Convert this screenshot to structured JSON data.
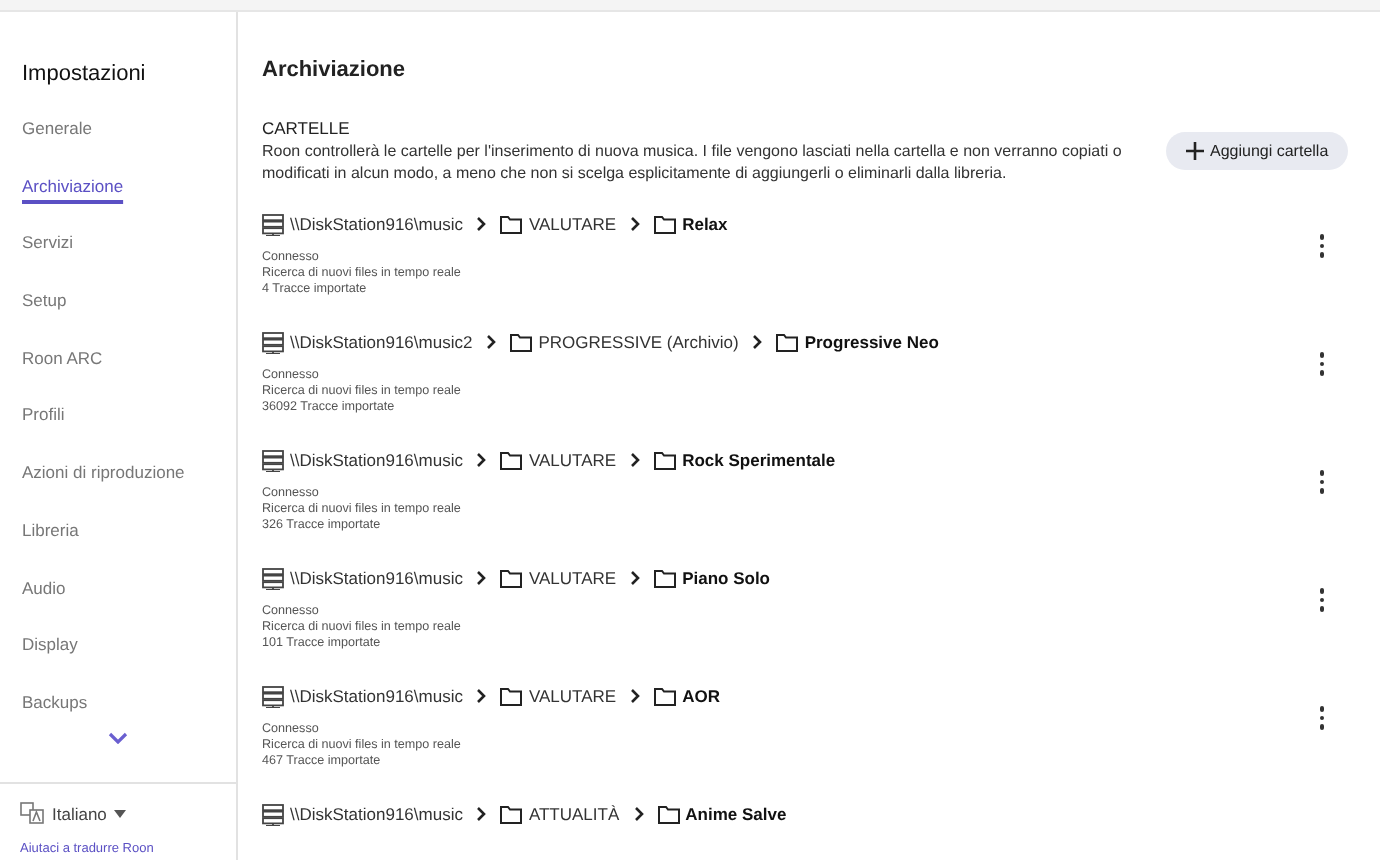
{
  "sidebar": {
    "title": "Impostazioni",
    "items": [
      {
        "label": "Generale",
        "selected": false
      },
      {
        "label": "Archiviazione",
        "selected": true
      },
      {
        "label": "Servizi",
        "selected": false
      },
      {
        "label": "Setup",
        "selected": false
      },
      {
        "label": "Roon ARC",
        "selected": false
      },
      {
        "label": "Profili",
        "selected": false
      },
      {
        "label": "Azioni di riproduzione",
        "selected": false
      },
      {
        "label": "Libreria",
        "selected": false
      },
      {
        "label": "Audio",
        "selected": false
      },
      {
        "label": "Display",
        "selected": false
      },
      {
        "label": "Backups",
        "selected": false
      }
    ],
    "language": "Italiano",
    "help_link": "Aiutaci a tradurre Roon"
  },
  "page_title": "Archiviazione",
  "section": {
    "heading": "CARTELLE",
    "description": "Roon controllerà le cartelle per l'inserimento di nuova musica. I file vengono lasciati nella cartella e non verranno copiati o modificati in alcun modo, a meno che non si scelga esplicitamente di aggiungerli o eliminarli dalla libreria.",
    "add_button": "Aggiungi cartella"
  },
  "folders": [
    {
      "share": "\\\\DiskStation916\\music",
      "parent": "VALUTARE",
      "name": "Relax",
      "status": [
        "Connesso",
        "Ricerca di nuovi files in tempo reale",
        "4 Tracce importate"
      ]
    },
    {
      "share": "\\\\DiskStation916\\music2",
      "parent": "PROGRESSIVE (Archivio)",
      "name": "Progressive Neo",
      "status": [
        "Connesso",
        "Ricerca di nuovi files in tempo reale",
        "36092 Tracce importate"
      ]
    },
    {
      "share": "\\\\DiskStation916\\music",
      "parent": "VALUTARE",
      "name": "Rock Sperimentale",
      "status": [
        "Connesso",
        "Ricerca di nuovi files in tempo reale",
        "326 Tracce importate"
      ]
    },
    {
      "share": "\\\\DiskStation916\\music",
      "parent": "VALUTARE",
      "name": "Piano Solo",
      "status": [
        "Connesso",
        "Ricerca di nuovi files in tempo reale",
        "101 Tracce importate"
      ]
    },
    {
      "share": "\\\\DiskStation916\\music",
      "parent": "VALUTARE",
      "name": "AOR",
      "status": [
        "Connesso",
        "Ricerca di nuovi files in tempo reale",
        "467 Tracce importate"
      ]
    },
    {
      "share": "\\\\DiskStation916\\music",
      "parent": "ATTUALITÀ",
      "name": "Anime Salve"
    }
  ]
}
